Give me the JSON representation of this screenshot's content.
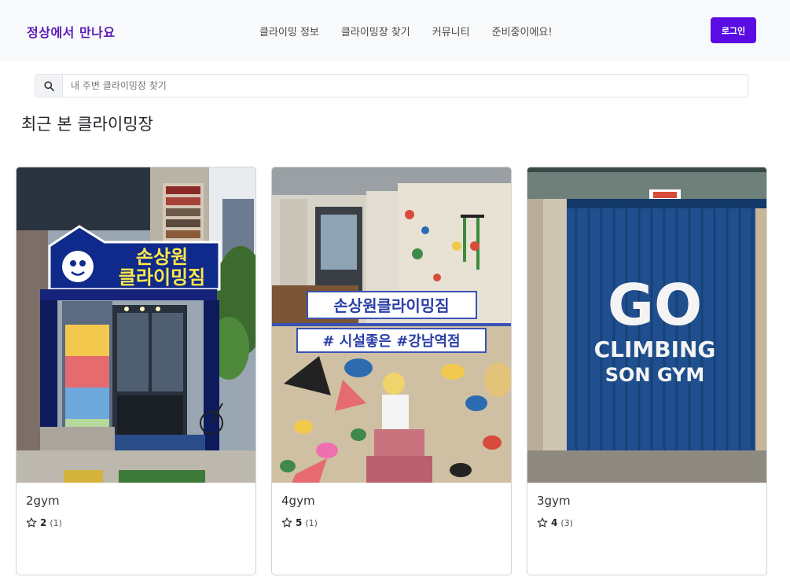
{
  "navbar": {
    "brand": "정상에서 만나요",
    "links": [
      {
        "label": "클라이밍 정보"
      },
      {
        "label": "클라이밍장 찾기"
      },
      {
        "label": "커뮤니티"
      },
      {
        "label": "준비중이에요!"
      }
    ],
    "login_label": "로그인"
  },
  "search": {
    "placeholder": "내 주변 클라이밍장 찾기",
    "icon": "search-icon"
  },
  "section_title": "최근 본 클라이밍장",
  "cards": [
    {
      "name": "2gym",
      "rating": "2",
      "reviews": "(1)",
      "sign_line1": "손상원",
      "sign_line2": "클라이밍짐"
    },
    {
      "name": "4gym",
      "rating": "5",
      "reviews": "(1)",
      "banner_line1": "손상원클라이밍짐",
      "banner_line2": "# 시설좋은 #강남역점"
    },
    {
      "name": "3gym",
      "rating": "4",
      "reviews": "(3)",
      "wall_line1": "GO",
      "wall_line2": "CLIMBING",
      "wall_line3": "SON GYM"
    }
  ],
  "colors": {
    "brand": "#5a1bb5",
    "login_button": "#5a0ce3",
    "navbar_bg": "#f8f9fa"
  }
}
